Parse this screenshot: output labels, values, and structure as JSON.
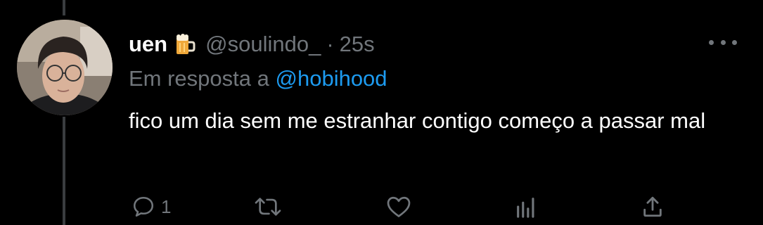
{
  "tweet": {
    "display_name": "uen",
    "emoji_icon": "beer-mug-icon",
    "handle": "@soulindo_",
    "separator": "·",
    "time": "25s",
    "reply_prefix": "Em resposta a",
    "reply_mention": "@hobihood",
    "text": "fico um dia sem me estranhar contigo começo a passar mal"
  },
  "actions": {
    "reply_count": "1",
    "icons": [
      "reply-icon",
      "retweet-icon",
      "like-icon",
      "analytics-icon",
      "share-icon"
    ]
  },
  "colors": {
    "background": "#000000",
    "text_primary": "#ffffff",
    "text_secondary": "#71767b",
    "accent": "#1d9bf0",
    "thread_line": "#3a3d40"
  }
}
